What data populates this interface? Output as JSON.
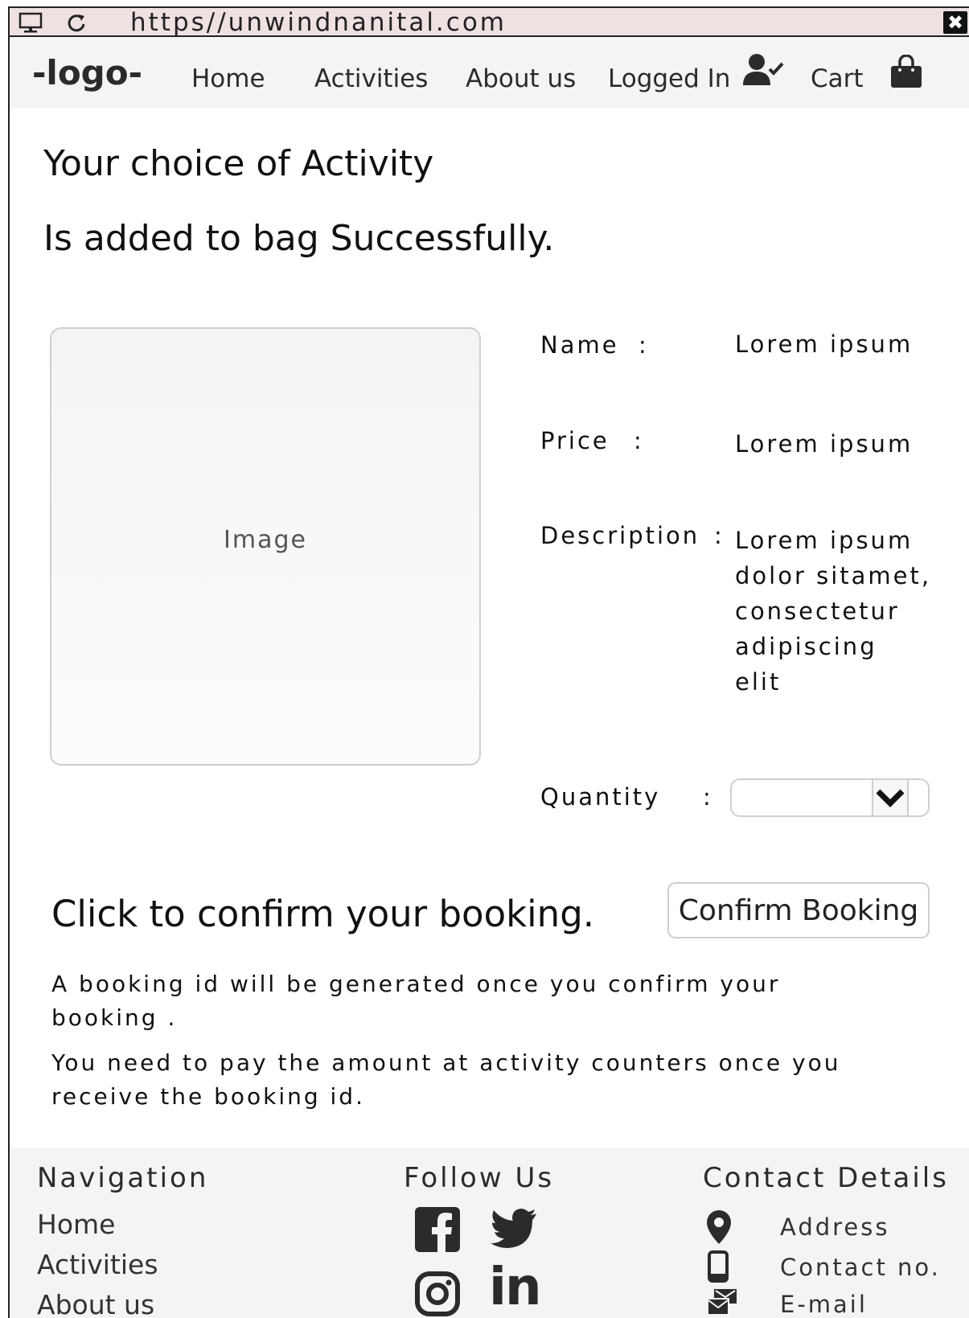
{
  "browser": {
    "url": "https//unwindnanital.com",
    "close_glyph": "✖",
    "icons": [
      "monitor-icon",
      "refresh-icon",
      "close-icon"
    ]
  },
  "nav": {
    "logo": "-logo-",
    "items": [
      "Home",
      "Activities",
      "About us"
    ],
    "logged_in": "Logged In",
    "cart": "Cart",
    "icons": [
      "user-check-icon",
      "shopping-bag-icon"
    ]
  },
  "heading": {
    "line1": "Your choice of Activity",
    "line2": "Is added to bag Successfully."
  },
  "product": {
    "image_label": "Image",
    "name_label": "Name",
    "name_value": "Lorem ipsum",
    "price_label": "Price",
    "price_value": "Lorem ipsum",
    "description_label": "Description",
    "description_lines": [
      "Lorem ipsum",
      "dolor sitamet,",
      "consectetur",
      "adipiscing",
      "elit"
    ],
    "quantity_label": "Quantity",
    "quantity_value": "",
    "colon": ":"
  },
  "confirm": {
    "text": "Click to confirm your booking.",
    "button": "Confirm Booking"
  },
  "notes": {
    "line1": "A booking id will be generated once you confirm your booking .",
    "line2": "You need to pay the amount at activity counters once you receive the booking id."
  },
  "footer": {
    "navigation_title": "Navigation",
    "navigation_items": [
      "Home",
      "Activities",
      "About us"
    ],
    "follow_title": "Follow Us",
    "social_icons": [
      "facebook-icon",
      "twitter-icon",
      "instagram-icon",
      "linkedin-icon"
    ],
    "linkedin_text": "in",
    "contact_title": "Contact Details",
    "contact_items": [
      "Address",
      "Contact no.",
      "E-mail"
    ],
    "contact_icons": [
      "map-pin-icon",
      "mobile-phone-icon",
      "mail-icon"
    ]
  },
  "colors": {
    "urlbar_bg": "#efe1e1",
    "nav_bg": "#f4f4f4",
    "footer_bg": "#f4f4f4",
    "text": "#1c1c1c",
    "border": "#cfcfcf"
  }
}
